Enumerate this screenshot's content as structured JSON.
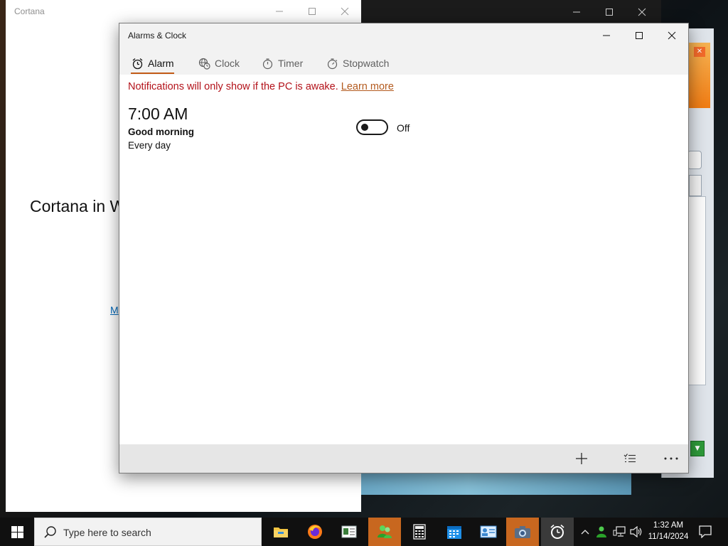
{
  "cortana_window": {
    "title": "Cortana",
    "heading": "Cortana in W",
    "link_text": "M"
  },
  "alarms_window": {
    "title": "Alarms & Clock",
    "tabs": [
      {
        "label": "Alarm",
        "icon": "alarm-icon",
        "active": true
      },
      {
        "label": "Clock",
        "icon": "world-clock-icon",
        "active": false
      },
      {
        "label": "Timer",
        "icon": "timer-icon",
        "active": false
      },
      {
        "label": "Stopwatch",
        "icon": "stopwatch-icon",
        "active": false
      }
    ],
    "notice": {
      "text": "Notifications will only show if the PC is awake.",
      "link": "Learn more",
      "color": "#b3121a"
    },
    "alarms": [
      {
        "time": "7:00 AM",
        "name": "Good morning",
        "repeat": "Every day",
        "enabled": false,
        "toggle_label": "Off"
      }
    ],
    "commands": [
      {
        "icon": "add-icon",
        "label": "Add new alarm"
      },
      {
        "icon": "select-alarms-icon",
        "label": "Select alarms"
      },
      {
        "icon": "more-icon",
        "label": "See more"
      }
    ],
    "accent_color": "#c25a16"
  },
  "taskbar": {
    "search_placeholder": "Type here to search",
    "apps": [
      {
        "icon": "file-explorer-icon",
        "state": "normal"
      },
      {
        "icon": "firefox-icon",
        "state": "normal"
      },
      {
        "icon": "news-app-icon",
        "state": "normal"
      },
      {
        "icon": "people-app-icon",
        "state": "highlight"
      },
      {
        "icon": "calculator-icon",
        "state": "normal"
      },
      {
        "icon": "calendar-icon",
        "state": "normal"
      },
      {
        "icon": "id-card-app-icon",
        "state": "normal"
      },
      {
        "icon": "camera-icon",
        "state": "highlight"
      },
      {
        "icon": "alarms-clock-icon",
        "state": "active"
      }
    ],
    "time": "1:32 AM",
    "date": "11/14/2024"
  }
}
